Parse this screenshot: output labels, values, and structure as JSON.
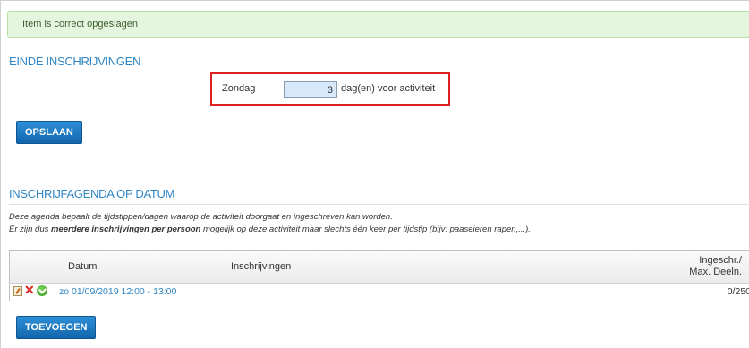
{
  "notification": {
    "success_text": "Item is correct opgeslagen"
  },
  "einde_inschrijvingen": {
    "title": "EINDE INSCHRIJVINGEN",
    "day_label": "Zondag",
    "days_value": "3",
    "days_suffix": "dag(en) voor activiteit",
    "save_button": "OPSLAAN"
  },
  "agenda": {
    "title": "INSCHRIJFAGENDA OP DATUM",
    "description_line1": "Deze agenda bepaalt de tijdstippen/dagen waarop de activiteit doorgaat en ingeschreven kan worden.",
    "description_line2_pre": "Er zijn dus ",
    "description_line2_bold": "meerdere inschrijvingen per persoon",
    "description_line2_post": " mogelijk op deze activiteit maar slechts één keer per tijdstip (bijv: paaseieren rapen,...).",
    "columns": {
      "datum": "Datum",
      "inschrijvingen": "Inschrijvingen",
      "ingeschreven_line1": "Ingeschr./",
      "ingeschreven_line2": "Max. Deeln."
    },
    "rows": [
      {
        "date": "zo 01/09/2019 12:00 - 13:00",
        "count": "0/250"
      }
    ],
    "add_button": "TOEVOEGEN"
  },
  "icons": {
    "edit": "edit-icon",
    "delete": "delete-icon",
    "confirm": "check-circle-icon"
  },
  "colors": {
    "accent": "#2f86c4",
    "button": "#1a74bd",
    "success_bg": "#e4f7de",
    "highlight_border": "#e02020"
  }
}
